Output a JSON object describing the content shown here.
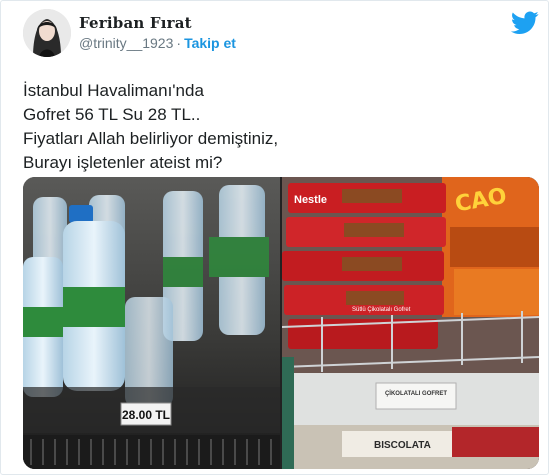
{
  "author": {
    "name": "Feriban Fırat",
    "handle": "@trinity__1923",
    "separator": "·",
    "follow_label": "Takip et"
  },
  "icons": {
    "brand": "twitter-bird-icon",
    "brand_color": "#1da1f2"
  },
  "tweet": {
    "lines": [
      "İstanbul Havalimanı'nda",
      "Gofret 56 TL Su 28 TL..",
      "Fiyatları Allah belirliyor demiştiniz,",
      "Burayı işletenler ateist mi?"
    ]
  },
  "media": {
    "left_photo": {
      "price_tag": "28.00 TL"
    },
    "right_photo": {
      "brand": "Nestle",
      "product": "Sütlü Çikolatalı Gofret",
      "snack": "CAO",
      "shelf_label": "ÇİKOLATALI GOFRET",
      "box": "BISCOLATA"
    }
  }
}
